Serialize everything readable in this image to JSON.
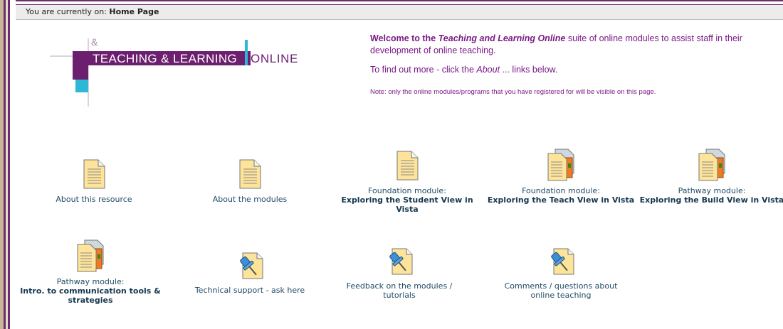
{
  "breadcrumb": {
    "prefix": "You are currently on: ",
    "page": "Home Page"
  },
  "logo": {
    "text_main": "TEACHING & LEARNING ",
    "text_online": "ONLINE",
    "ampersand": "&",
    "colors": {
      "purple": "#6b1f6e",
      "cyan": "#2fb7d6",
      "gray": "#6d6d6d"
    }
  },
  "welcome": {
    "line1_prefix": "Welcome to the ",
    "line1_em": "Teaching and Learning Online",
    "line1_suffix": " suite of online modules to assist staff in their development of online teaching.",
    "line2_prefix": "To find out more - click the ",
    "line2_em": "About",
    "line2_suffix": " ... links below.",
    "note": "Note: only the online modules/programs that you have registered for will be visible on this page."
  },
  "tiles": [
    {
      "label": "About this resource",
      "sub": "",
      "icon": "document-icon"
    },
    {
      "label": "About the modules",
      "sub": "",
      "icon": "document-icon"
    },
    {
      "label": "Foundation module:",
      "sub": "Exploring the Student View in Vista",
      "icon": "document-icon"
    },
    {
      "label": "Foundation module:",
      "sub": "Exploring the Teach View in Vista",
      "icon": "learning-module-icon"
    },
    {
      "label": "Pathway module:",
      "sub": "Exploring the Build View in Vista",
      "icon": "learning-module-icon"
    },
    {
      "label": "Pathway module:",
      "sub": "Intro. to communication tools & strategies",
      "icon": "learning-module-icon"
    },
    {
      "label": "Technical support - ask here",
      "sub": "",
      "icon": "pushpin-note-icon"
    },
    {
      "label": "Feedback on the modules / tutorials",
      "sub": "",
      "icon": "pushpin-note-icon"
    },
    {
      "label": "Comments / questions about online teaching",
      "sub": "",
      "icon": "pushpin-note-icon"
    }
  ]
}
